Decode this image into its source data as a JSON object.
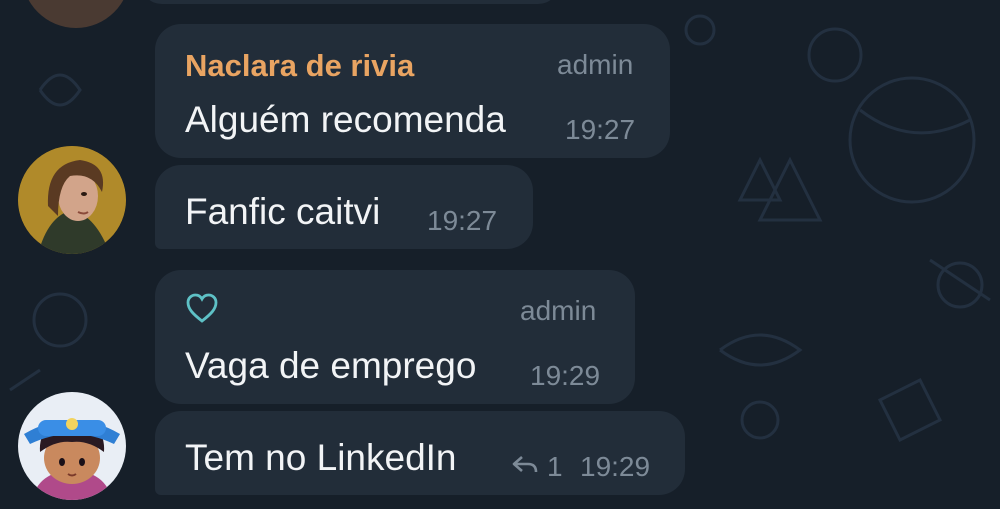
{
  "messages": [
    {
      "sender": "Naclara de rivia",
      "role": "admin",
      "text": "Alguém recomenda",
      "time": "19:27"
    },
    {
      "text": "Fanfic caitvi",
      "time": "19:27",
      "avatar": "avatar-girl-brown-hair"
    },
    {
      "role": "admin",
      "text": "Vaga de emprego",
      "time": "19:29",
      "icon": "heart-outline-icon"
    },
    {
      "text": "Tem no LinkedIn",
      "time": "19:29",
      "replies": "1",
      "avatar": "avatar-cartoon-blue-hat"
    }
  ],
  "colors": {
    "background": "#161f29",
    "bubble": "#222d39",
    "sender_name": "#e9a462",
    "meta": "#7d8a97",
    "heart": "#5ec1c6"
  }
}
